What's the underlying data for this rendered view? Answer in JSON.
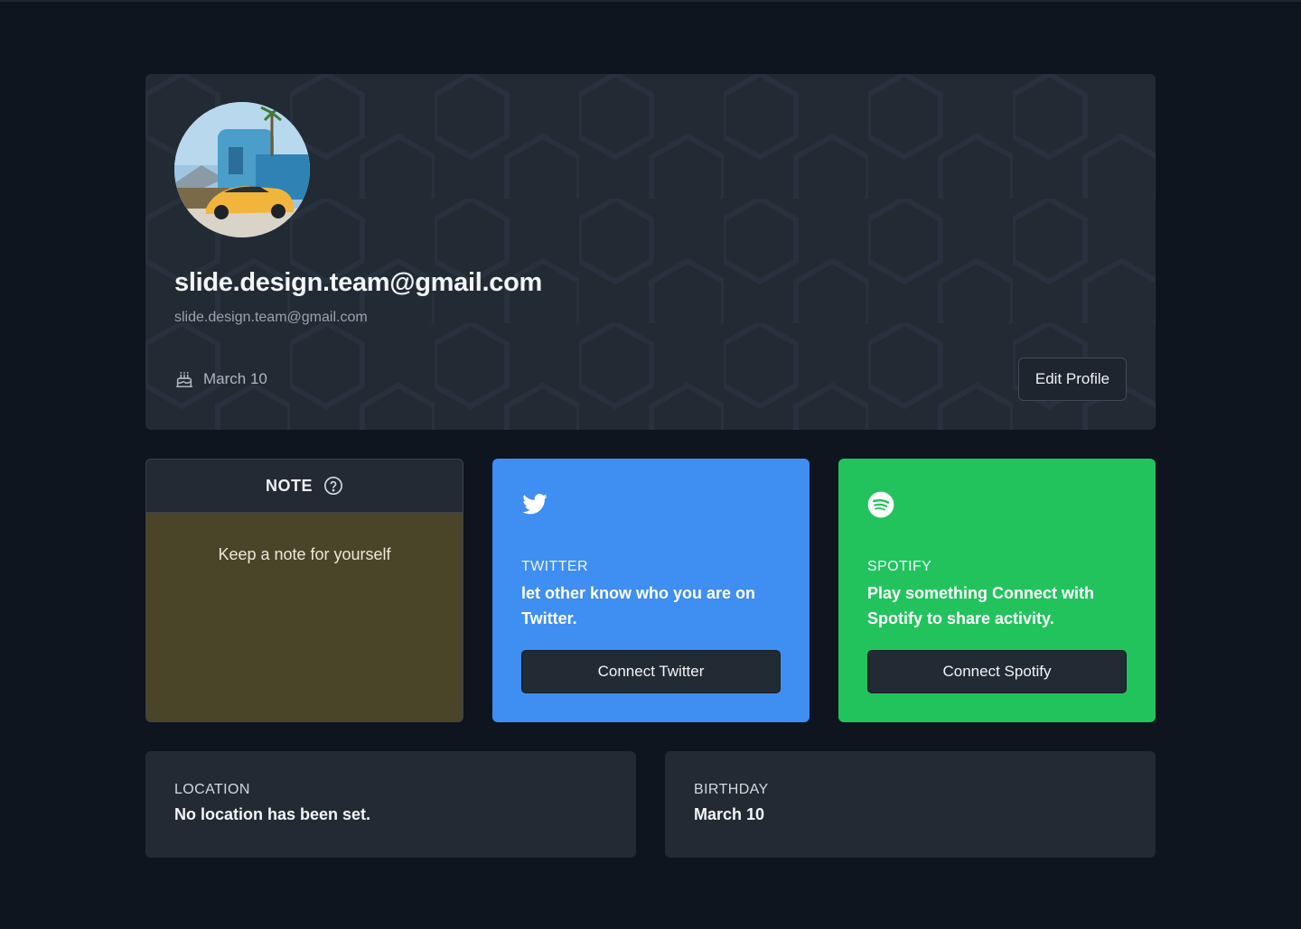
{
  "profile": {
    "display_name": "slide.design.team@gmail.com",
    "email": "slide.design.team@gmail.com",
    "birthday": "March 10",
    "edit_label": "Edit Profile",
    "birthday_icon": "cake-icon"
  },
  "note": {
    "title": "NOTE",
    "help_icon": "help-circle-icon",
    "placeholder": "Keep a note for yourself",
    "background": "#4a4428"
  },
  "twitter": {
    "icon": "twitter-bird-icon",
    "label": "TWITTER",
    "description": "let other know who you are on Twitter.",
    "button": "Connect Twitter",
    "color": "#3f8ef1"
  },
  "spotify": {
    "icon": "spotify-icon",
    "label": "SPOTIFY",
    "description": "Play something Connect with Spotify to share activity.",
    "button": "Connect Spotify",
    "color": "#22c35d"
  },
  "location": {
    "label": "LOCATION",
    "value": "No location has been set."
  },
  "birthday_card": {
    "label": "BIRTHDAY",
    "value": "March 10"
  }
}
